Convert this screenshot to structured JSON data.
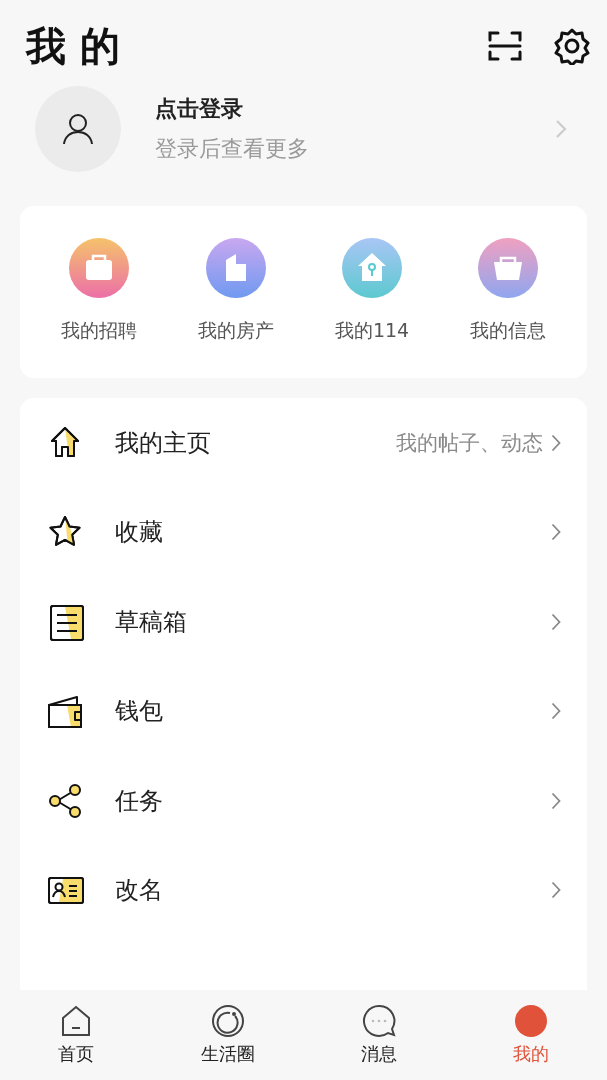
{
  "header": {
    "title": "我 的"
  },
  "profile": {
    "name": "点击登录",
    "subtitle": "登录后查看更多"
  },
  "shortcuts": [
    {
      "label": "我的招聘"
    },
    {
      "label": "我的房产"
    },
    {
      "label": "我的114"
    },
    {
      "label": "我的信息"
    }
  ],
  "menu": [
    {
      "label": "我的主页",
      "hint": "我的帖子、动态"
    },
    {
      "label": "收藏"
    },
    {
      "label": "草稿箱"
    },
    {
      "label": "钱包"
    },
    {
      "label": "任务"
    },
    {
      "label": "改名"
    }
  ],
  "tabs": [
    {
      "label": "首页",
      "selected": false
    },
    {
      "label": "生活圈",
      "selected": false
    },
    {
      "label": "消息",
      "selected": false
    },
    {
      "label": "我的",
      "selected": true
    }
  ]
}
